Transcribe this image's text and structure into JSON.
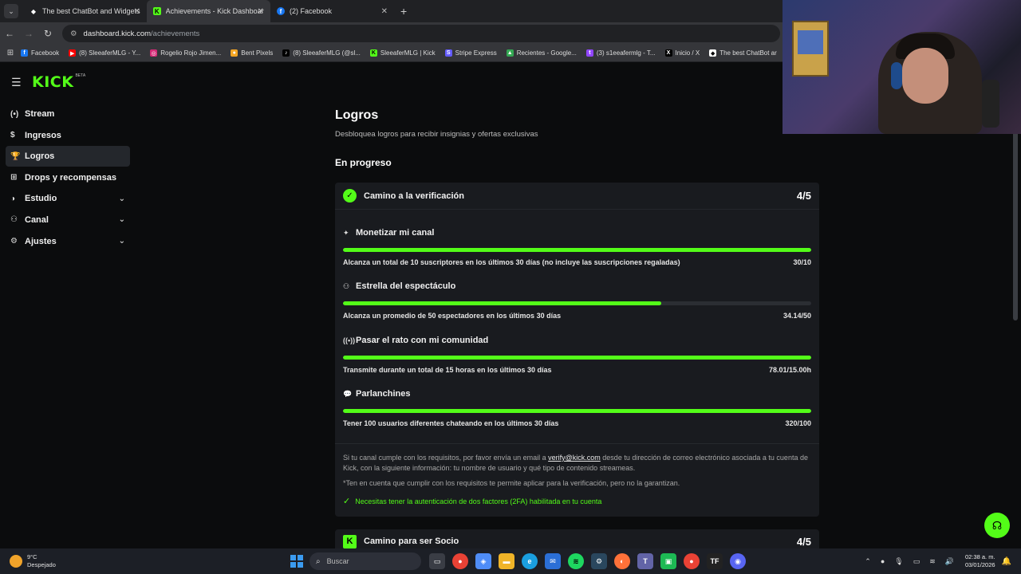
{
  "browser": {
    "tabs": [
      {
        "label": "The best ChatBot and Widgets",
        "icon": "diamond-favicon"
      },
      {
        "label": "Achievements - Kick Dashboard",
        "icon": "kick-favicon"
      },
      {
        "label": "(2) Facebook",
        "icon": "facebook-favicon"
      }
    ],
    "url_host": "dashboard.kick.com",
    "url_path": "/achievements",
    "bookmarks": [
      {
        "label": "Facebook",
        "color": "#1877f2",
        "glyph": "f"
      },
      {
        "label": "(8) SleeaferMLG - Y...",
        "color": "#ff0000",
        "glyph": "▶"
      },
      {
        "label": "Rogelio Rojo Jimen...",
        "color": "#d62976",
        "glyph": "◎"
      },
      {
        "label": "Bent Pixels",
        "color": "#f5a623",
        "glyph": "●"
      },
      {
        "label": "(8) SleeaferMLG (@sl...",
        "color": "#000000",
        "glyph": "♪"
      },
      {
        "label": "SleeaferMLG | Kick",
        "color": "#53fc18",
        "glyph": "K"
      },
      {
        "label": "Stripe Express",
        "color": "#635bff",
        "glyph": "S"
      },
      {
        "label": "Recientes - Google...",
        "color": "#34a853",
        "glyph": "▲"
      },
      {
        "label": "(3) s1eeafermlg - T...",
        "color": "#9146ff",
        "glyph": "t"
      },
      {
        "label": "Inicio / X",
        "color": "#000000",
        "glyph": "X"
      },
      {
        "label": "The best ChatBot ar",
        "color": "#ffffff",
        "glyph": "◆"
      }
    ]
  },
  "sidebar": {
    "logo": "KICK",
    "logo_badge": "BETA",
    "items": [
      {
        "label": "Stream",
        "icon": "broadcast-icon",
        "glyph": "(•)"
      },
      {
        "label": "Ingresos",
        "icon": "dollar-icon",
        "glyph": "$"
      },
      {
        "label": "Logros",
        "icon": "trophy-icon",
        "glyph": "🏆"
      },
      {
        "label": "Drops y recompensas",
        "icon": "gift-icon",
        "glyph": "⊞"
      },
      {
        "label": "Estudio",
        "icon": "studio-icon",
        "glyph": "◑"
      },
      {
        "label": "Canal",
        "icon": "channel-icon",
        "glyph": "⚇"
      },
      {
        "label": "Ajustes",
        "icon": "gear-icon",
        "glyph": "⚙"
      }
    ]
  },
  "main": {
    "title": "Logros",
    "subtitle": "Desbloquea logros para recibir insignias y ofertas exclusivas",
    "section": "En progreso",
    "card": {
      "title": "Camino a la verificación",
      "count": "4/5",
      "tasks": [
        {
          "title": "Monetizar mi canal",
          "icon": "sparkle-icon",
          "glyph": "✦",
          "description": "Alcanza un total de 10 suscriptores en los últimos 30 días (no incluye las suscripciones regaladas)",
          "value": "30/10",
          "progress": 1.0
        },
        {
          "title": "Estrella del espectáculo",
          "icon": "viewers-icon",
          "glyph": "⚇",
          "description": "Alcanza un promedio de 50 espectadores en los últimos 30 días",
          "value": "34.14/50",
          "progress": 0.68
        },
        {
          "title": "Pasar el rato con mi comunidad",
          "icon": "broadcast-icon",
          "glyph": "((•))",
          "description": "Transmite durante un total de 15 horas en los últimos 30 días",
          "value": "78.01/15.00h",
          "progress": 1.0
        },
        {
          "title": "Parlanchines",
          "icon": "chat-icon",
          "glyph": "💬",
          "description": "Tener 100 usuarios diferentes chateando en los últimos 30 días",
          "value": "320/100",
          "progress": 1.0
        }
      ],
      "note_pre": "Si tu canal cumple con los requisitos, por favor envía un email a ",
      "note_email": "verify@kick.com",
      "note_post": " desde tu dirección de correo electrónico asociada a tu cuenta de Kick, con la siguiente información: tu nombre de usuario y qué tipo de contenido streameas.",
      "note2": "*Ten en cuenta que cumplir con los requisitos te permite aplicar para la verificación, pero no la garantizan.",
      "twofa": "Necesitas tener la autenticación de dos factores (2FA) habilitada en tu cuenta"
    },
    "card2": {
      "title": "Camino para ser Socio",
      "count": "4/5"
    }
  },
  "taskbar": {
    "temp": "9°C",
    "weather": "Despejado",
    "weather_badge": "1",
    "search_placeholder": "Buscar",
    "time": "02:38 a. m.",
    "date": "03/01/2026"
  },
  "colors": {
    "accent": "#53fc18",
    "panel": "#191b1f",
    "background": "#0b0c0d"
  }
}
